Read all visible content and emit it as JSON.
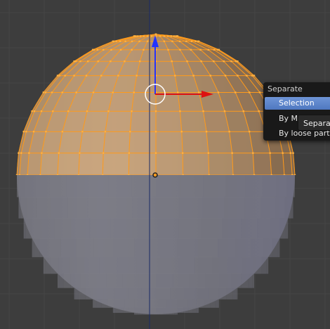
{
  "app": "3D viewport",
  "colors": {
    "background": "#3d3d3d",
    "grid": "#444444",
    "wire": "#ff9a1a",
    "selected_face": "#a07e5c",
    "unselected_face": "#6d6d75",
    "axis_z": "#2233ff",
    "axis_x": "#dd1111",
    "menu_bg": "#191919",
    "menu_highlight": "#5a82c8"
  },
  "menu": {
    "title": "Separate",
    "items": [
      {
        "label": "Selection",
        "active": true
      },
      {
        "label": "By Material",
        "active": false
      },
      {
        "label": "By loose parts",
        "active": false
      }
    ]
  },
  "tooltip": {
    "text": "Separate"
  },
  "icons": {
    "cursor": "3d-cursor-icon",
    "gizmo_z": "z-axis-arrow-icon",
    "gizmo_x": "x-axis-arrow-icon",
    "pivot": "pivot-point-icon"
  }
}
